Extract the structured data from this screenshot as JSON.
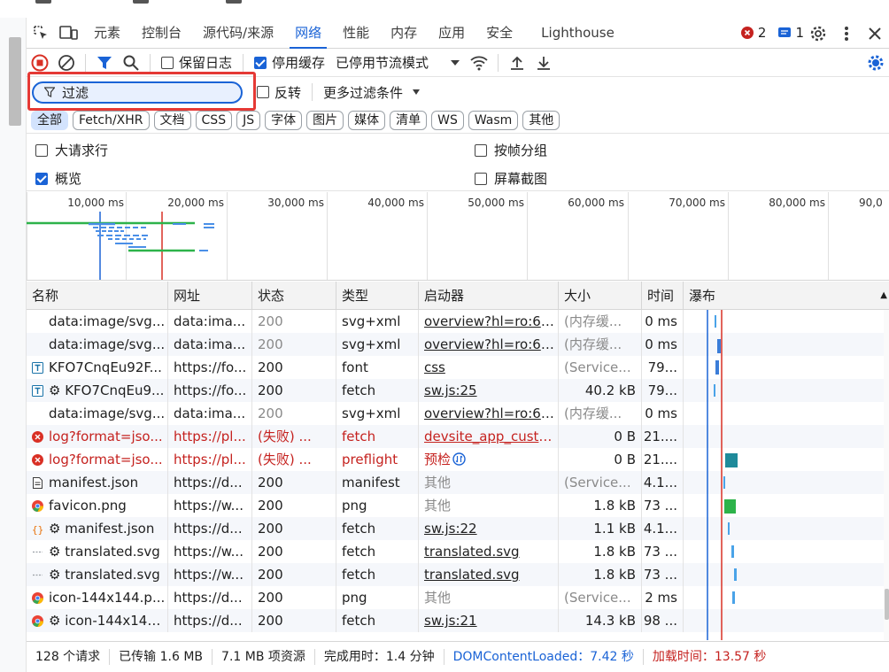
{
  "tabs": [
    "元素",
    "控制台",
    "源代码/来源",
    "网络",
    "性能",
    "内存",
    "应用",
    "安全",
    "Lighthouse"
  ],
  "active_tab": "网络",
  "badges": {
    "errors": "2",
    "messages": "1"
  },
  "toolbar": {
    "preserve_log": "保留日志",
    "disable_cache": "停用缓存",
    "throttle": "已停用节流模式"
  },
  "filter": {
    "placeholder": "过滤",
    "invert": "反转",
    "more_filters": "更多过滤条件"
  },
  "type_filters": [
    "全部",
    "Fetch/XHR",
    "文档",
    "CSS",
    "JS",
    "字体",
    "图片",
    "媒体",
    "清单",
    "WS",
    "Wasm",
    "其他"
  ],
  "options": {
    "large_rows": "大请求行",
    "overview": "概览",
    "group_by_frame": "按帧分组",
    "screenshots": "屏幕截图"
  },
  "timeline_ticks": [
    "10,000 ms",
    "20,000 ms",
    "30,000 ms",
    "40,000 ms",
    "50,000 ms",
    "60,000 ms",
    "70,000 ms",
    "80,000 ms",
    "90,0"
  ],
  "columns": [
    "名称",
    "网址",
    "状态",
    "类型",
    "启动器",
    "大小",
    "时间",
    "瀑布"
  ],
  "rows": [
    {
      "icon": "none",
      "name": "data:image/svg...",
      "url": "data:ima...",
      "status": "200",
      "type": "svg+xml",
      "initiator": "overview?hl=ro:6550",
      "size": "(内存缓...",
      "time": "0 ms",
      "kind": "memory"
    },
    {
      "icon": "none",
      "name": "data:image/svg...",
      "url": "data:ima...",
      "status": "200",
      "type": "svg+xml",
      "initiator": "overview?hl=ro:6550",
      "size": "(内存缓...",
      "time": "0 ms",
      "kind": "memory"
    },
    {
      "icon": "font",
      "name": "KFO7CnqEu92F...",
      "url": "https://fo...",
      "status": "200",
      "type": "font",
      "initiator": "css",
      "size": "(Service...",
      "time": "79...",
      "kind": "sw"
    },
    {
      "icon": "font",
      "name": "⚙ KFO7CnqEu9...",
      "url": "https://fo...",
      "status": "200",
      "type": "fetch",
      "initiator": "sw.js:25",
      "size": "40.2 kB",
      "time": "79...",
      "kind": "normal"
    },
    {
      "icon": "none",
      "name": "data:image/svg...",
      "url": "data:ima...",
      "status": "200",
      "type": "svg+xml",
      "initiator": "overview?hl=ro:6550",
      "size": "(内存缓...",
      "time": "0 ms",
      "kind": "memory"
    },
    {
      "icon": "error",
      "name": "log?format=jso...",
      "url": "https://pl...",
      "status": "(失败) ...",
      "type": "fetch",
      "initiator": "devsite_app_custom_",
      "size": "0 B",
      "time": "21....",
      "kind": "error"
    },
    {
      "icon": "error",
      "name": "log?format=jso...",
      "url": "https://pl...",
      "status": "(失败) ...",
      "type": "preflight",
      "initiator": "预检",
      "size": "0 B",
      "time": "21....",
      "kind": "error"
    },
    {
      "icon": "doc",
      "name": "manifest.json",
      "url": "https://d...",
      "status": "200",
      "type": "manifest",
      "initiator": "其他",
      "size": "(Service...",
      "time": "4.1...",
      "kind": "sw"
    },
    {
      "icon": "chrome",
      "name": "favicon.png",
      "url": "https://w...",
      "status": "200",
      "type": "png",
      "initiator": "其他",
      "size": "1.8 kB",
      "time": "73 ...",
      "kind": "normal"
    },
    {
      "icon": "json",
      "name": "⚙ manifest.json",
      "url": "https://d...",
      "status": "200",
      "type": "fetch",
      "initiator": "sw.js:22",
      "size": "1.1 kB",
      "time": "4.1...",
      "kind": "normal"
    },
    {
      "icon": "dash",
      "name": "⚙ translated.svg",
      "url": "https://w...",
      "status": "200",
      "type": "fetch",
      "initiator": "translated.svg",
      "size": "1.8 kB",
      "time": "73 ...",
      "kind": "normal"
    },
    {
      "icon": "dash",
      "name": "⚙ translated.svg",
      "url": "https://w...",
      "status": "200",
      "type": "fetch",
      "initiator": "translated.svg",
      "size": "1.8 kB",
      "time": "73 ...",
      "kind": "normal"
    },
    {
      "icon": "chrome",
      "name": "icon-144x144.p...",
      "url": "https://d...",
      "status": "200",
      "type": "png",
      "initiator": "其他",
      "size": "(Service...",
      "time": "2 ms",
      "kind": "sw"
    },
    {
      "icon": "chrome",
      "name": "⚙ icon-144x144...",
      "url": "https://d...",
      "status": "200",
      "type": "fetch",
      "initiator": "sw.js:21",
      "size": "14.3 kB",
      "time": "98 ...",
      "kind": "normal"
    }
  ],
  "status_bar": {
    "requests": "128 个请求",
    "transferred": "已传输 1.6 MB",
    "resources": "7.1 MB 项资源",
    "finish": "完成用时：1.4 分钟",
    "dcl": "DOMContentLoaded：7.42 秒",
    "load": "加载时间：13.57 秒"
  },
  "colors": {
    "accent": "#1a63d6",
    "error": "#c5221f",
    "highlight": "#e53935"
  }
}
